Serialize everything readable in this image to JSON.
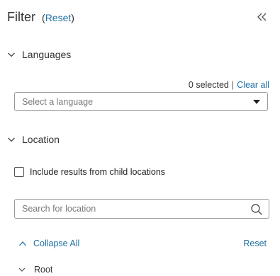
{
  "header": {
    "title": "Filter",
    "reset_open": "(",
    "reset_label": "Reset",
    "reset_close": ")",
    "collapse_icon": "double-chevron-left-icon"
  },
  "languages": {
    "section_label": "Languages",
    "selected_count_text": "0 selected",
    "separator": "|",
    "clear_all_label": "Clear all",
    "select_placeholder": "Select a language"
  },
  "location": {
    "section_label": "Location",
    "checkbox_label": "Include results from child locations",
    "checkbox_checked": false,
    "search_placeholder": "Search for location",
    "collapse_all_label": "Collapse All",
    "reset_label": "Reset",
    "tree": [
      {
        "label": "Root",
        "expanded": true
      }
    ]
  },
  "colors": {
    "link": "#1d6fa5",
    "text": "#333333",
    "border": "#9a9a9a"
  }
}
